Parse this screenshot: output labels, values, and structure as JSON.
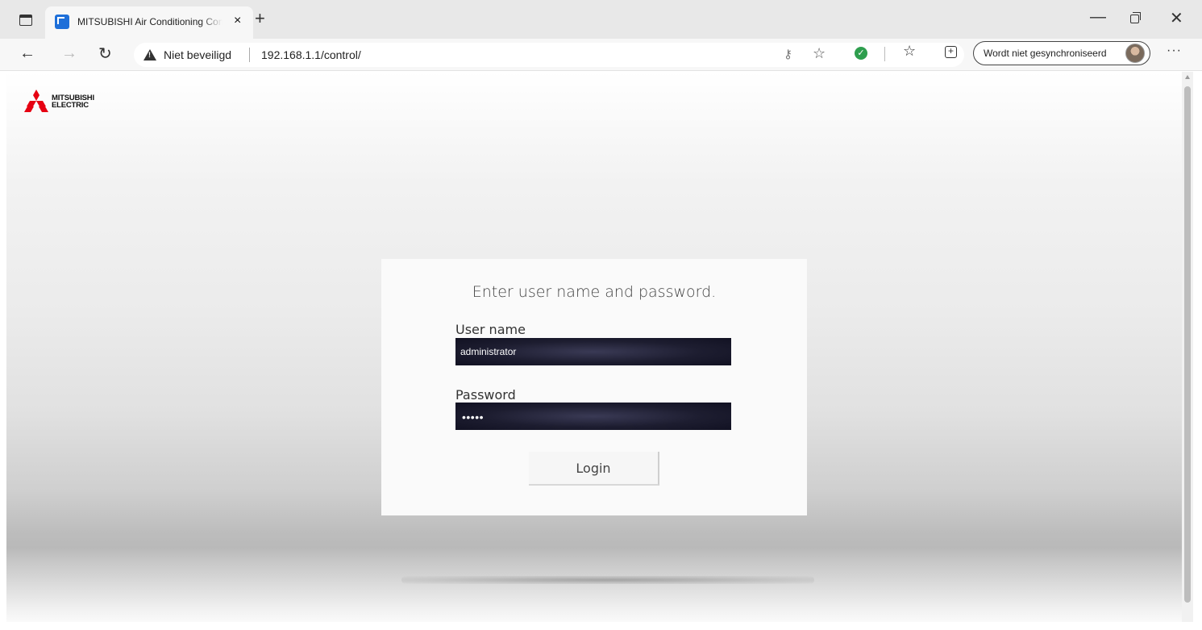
{
  "browser": {
    "tab_title": "MITSUBISHI Air Conditioning Control",
    "tab_close": "×",
    "new_tab": "+",
    "security_label": "Niet beveiligd",
    "url": "192.168.1.1/control/",
    "sync_status": "Wordt niet gesynchroniseerd",
    "more": "···"
  },
  "page": {
    "logo_line1": "MITSUBISHI",
    "logo_line2": "ELECTRIC",
    "login": {
      "heading": "Enter user name and password.",
      "username_label": "User name",
      "username_value": "administrator",
      "password_label": "Password",
      "password_masked": "•••••",
      "login_button": "Login"
    }
  },
  "colors": {
    "brand_red": "#e60012",
    "input_dark": "#1d1d30",
    "sync_check": "#2e9e4e"
  }
}
